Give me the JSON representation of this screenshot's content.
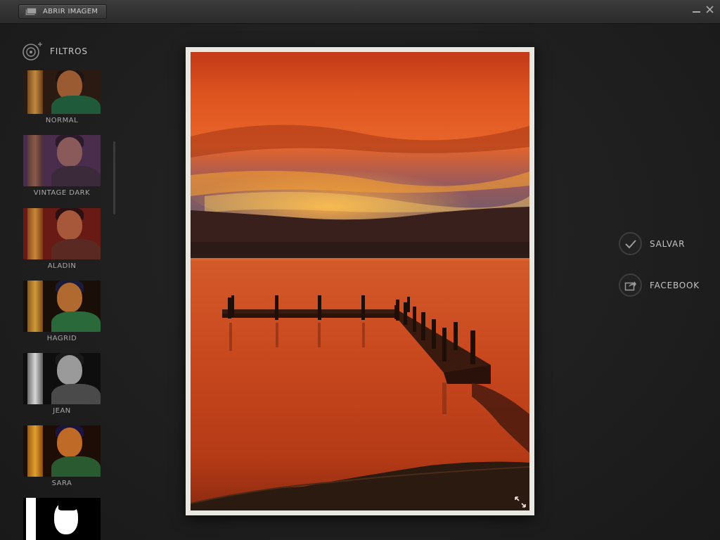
{
  "toolbar": {
    "open_image_label": "ABRIR IMAGEM",
    "minimize_glyph": "–",
    "close_glyph": "✕"
  },
  "filters": {
    "title": "FILTROS",
    "items": [
      {
        "label": "NORMAL"
      },
      {
        "label": "VINTAGE DARK"
      },
      {
        "label": "ALADIN"
      },
      {
        "label": "HAGRID"
      },
      {
        "label": "JEAN"
      },
      {
        "label": "SARA"
      },
      {
        "label": ""
      }
    ]
  },
  "actions": {
    "save_label": "SALVAR",
    "facebook_label": "FACEBOOK"
  },
  "icons": {
    "open_image": "folder-icon",
    "filters": "film-reel-icon",
    "save": "checkmark-icon",
    "facebook": "share-icon",
    "expand": "expand-icon"
  },
  "colors": {
    "background": "#1f1f1f",
    "topbar": "#333333",
    "photo_frame": "#e9e7e2",
    "sky_orange": "#e0521e",
    "water_orange": "#c9441c"
  }
}
